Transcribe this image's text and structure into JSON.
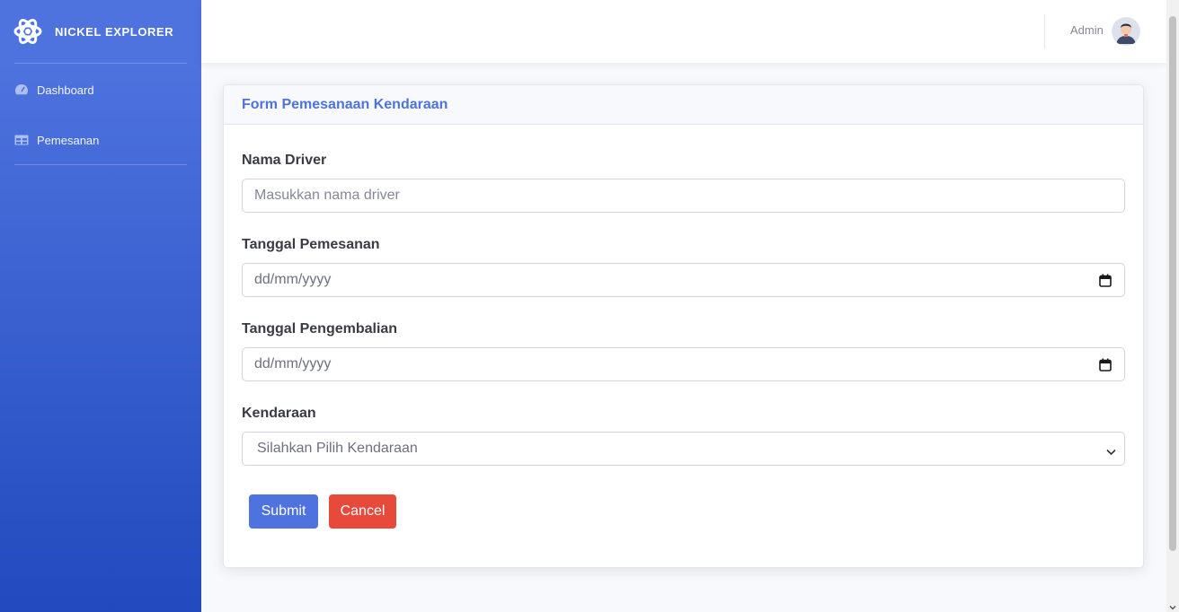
{
  "brand": {
    "name": "NICKEL EXPLORER",
    "icon": "atom-icon"
  },
  "sidebar": {
    "items": [
      {
        "label": "Dashboard",
        "icon": "tachometer-icon"
      },
      {
        "label": "Pemesanan",
        "icon": "table-icon"
      }
    ]
  },
  "topbar": {
    "user_name": "Admin",
    "avatar": "user-avatar"
  },
  "form": {
    "title": "Form Pemesanaan Kendaraan",
    "driver": {
      "label": "Nama Driver",
      "placeholder": "Masukkan nama driver"
    },
    "order_date": {
      "label": "Tanggal Pemesanan",
      "placeholder": "dd/mm/yyyy",
      "icon": "calendar-icon"
    },
    "return_date": {
      "label": "Tanggal Pengembalian",
      "placeholder": "dd/mm/yyyy",
      "icon": "calendar-icon"
    },
    "vehicle": {
      "label": "Kendaraan",
      "selected": "Silahkan Pilih Kendaraan",
      "icon": "chevron-down-icon"
    },
    "submit_label": "Submit",
    "cancel_label": "Cancel"
  },
  "colors": {
    "primary": "#4e73df",
    "danger": "#e74a3b",
    "sidebar_dark": "#224abe"
  }
}
